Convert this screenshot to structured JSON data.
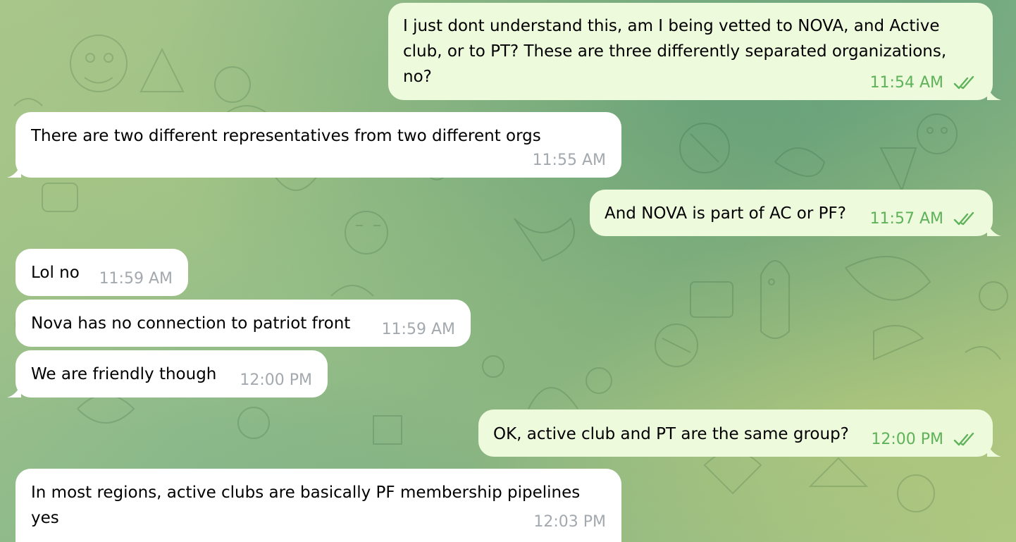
{
  "messages": [
    {
      "id": "m1",
      "direction": "out",
      "text": "I just dont understand this, am I being vetted to NOVA, and Active club, or to PT? These are three differently separated organizations, no?",
      "time": "11:54 AM",
      "status_icon": "double-check-icon"
    },
    {
      "id": "m2",
      "direction": "in",
      "text": "There are two different representatives from two different orgs",
      "time": "11:55 AM"
    },
    {
      "id": "m3",
      "direction": "out",
      "text": "And NOVA is part of AC or PF?",
      "time": "11:57 AM",
      "status_icon": "double-check-icon"
    },
    {
      "id": "m4",
      "direction": "in",
      "text": "Lol no",
      "time": "11:59 AM"
    },
    {
      "id": "m5",
      "direction": "in",
      "text": "Nova has no connection to patriot front",
      "time": "11:59 AM"
    },
    {
      "id": "m6",
      "direction": "in",
      "text": "We are friendly though",
      "time": "12:00 PM"
    },
    {
      "id": "m7",
      "direction": "out",
      "text": "OK, active club and PT are the same group?",
      "time": "12:00 PM",
      "status_icon": "double-check-icon"
    },
    {
      "id": "m8",
      "direction": "in",
      "text": "In most regions, active clubs are basically PF membership pipelines\nyes",
      "time": "12:03 PM"
    }
  ],
  "colors": {
    "incoming_bubble": "#ffffff",
    "outgoing_bubble": "#eefadc",
    "outgoing_meta": "#5eb25a",
    "incoming_meta": "#a3a9ae"
  }
}
